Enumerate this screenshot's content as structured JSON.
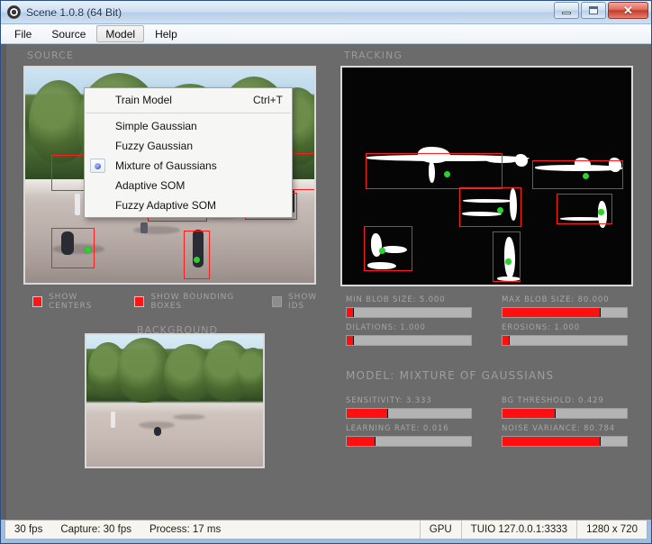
{
  "window": {
    "title": "Scene 1.0.8 (64 Bit)",
    "app_icon": "record-circle-icon",
    "buttons": {
      "minimize": "minimize-icon",
      "maximize": "maximize-icon",
      "close": "✕"
    }
  },
  "menubar": {
    "items": [
      {
        "label": "File",
        "active": false
      },
      {
        "label": "Source",
        "active": false
      },
      {
        "label": "Model",
        "active": true
      },
      {
        "label": "Help",
        "active": false
      }
    ]
  },
  "model_menu": {
    "open": true,
    "items": [
      {
        "label": "Train Model",
        "accel": "Ctrl+T",
        "selected": false
      },
      {
        "label": "Simple Gaussian",
        "accel": "",
        "selected": false
      },
      {
        "label": "Fuzzy Gaussian",
        "accel": "",
        "selected": false
      },
      {
        "label": "Mixture of Gaussians",
        "accel": "",
        "selected": true
      },
      {
        "label": "Adaptive SOM",
        "accel": "",
        "selected": false
      },
      {
        "label": "Fuzzy Adaptive SOM",
        "accel": "",
        "selected": false
      }
    ]
  },
  "panels": {
    "source_title": "SOURCE",
    "tracking_title": "TRACKING",
    "background_title": "BACKGROUND"
  },
  "toggles": [
    {
      "label": "SHOW CENTERS",
      "checked": true,
      "color": "#ff1515"
    },
    {
      "label": "SHOW BOUNDING BOXES",
      "checked": true,
      "color": "#ff1515"
    },
    {
      "label": "SHOW IDS",
      "checked": false,
      "color": "#8d8d8d"
    }
  ],
  "blob_sliders": [
    {
      "name": "min-blob-size",
      "label": "MIN BLOB SIZE: 5.000",
      "value": 5.0,
      "fill_pct": 6
    },
    {
      "name": "max-blob-size",
      "label": "MAX BLOB SIZE: 80.000",
      "value": 80.0,
      "fill_pct": 79
    },
    {
      "name": "dilations",
      "label": "DILATIONS: 1.000",
      "value": 1.0,
      "fill_pct": 6
    },
    {
      "name": "erosions",
      "label": "EROSIONS: 1.000",
      "value": 1.0,
      "fill_pct": 6
    }
  ],
  "model_section": {
    "heading": "MODEL: MIXTURE OF GAUSSIANS",
    "sliders": [
      {
        "name": "sensitivity",
        "label": "SENSITIVITY: 3.333",
        "value": 3.333,
        "fill_pct": 33
      },
      {
        "name": "bg-threshold",
        "label": "BG THRESHOLD: 0.429",
        "value": 0.429,
        "fill_pct": 43
      },
      {
        "name": "learning-rate",
        "label": "LEARNING RATE: 0.016",
        "value": 0.016,
        "fill_pct": 23
      },
      {
        "name": "noise-variance",
        "label": "NOISE VARIANCE: 80.784",
        "value": 80.784,
        "fill_pct": 79
      }
    ]
  },
  "statusbar": {
    "fps": "30 fps",
    "capture": "Capture:  30 fps",
    "process": "Process:  17 ms",
    "gpu": "GPU",
    "tuio": "TUIO 127.0.0.1:3333",
    "resolution": "1280 x 720"
  },
  "colors": {
    "accent_red": "#ff0f0f",
    "center_dot_green": "#2ad42a",
    "panel_bg": "#6b6b6b",
    "label_gray": "#a3a3a3"
  }
}
